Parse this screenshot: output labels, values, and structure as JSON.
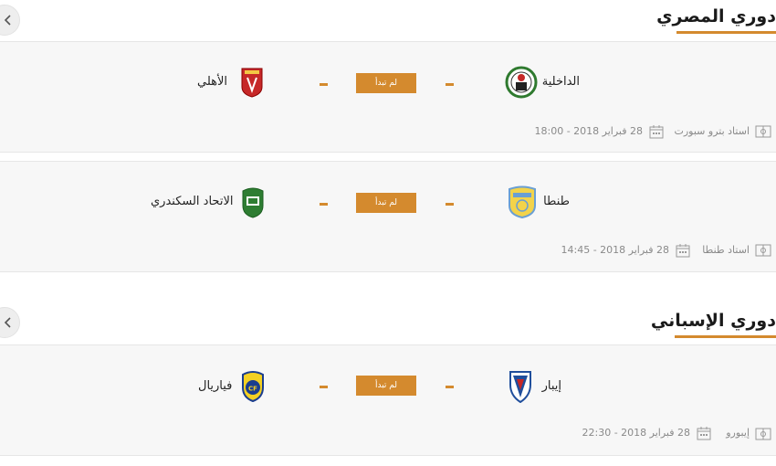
{
  "leagues": [
    {
      "title": "دوري المصري",
      "matches": [
        {
          "home_team": "الداخلية",
          "away_team": "الأهلي",
          "score_home": "-",
          "score_away": "-",
          "status": "لم تبدأ",
          "stadium": "استاد بترو سبورت",
          "date_time": "28 فبراير 2018 - 18:00",
          "home_logo_icon": "aldakhleya-crest-icon",
          "away_logo_icon": "al-ahly-crest-icon"
        },
        {
          "home_team": "طنطا",
          "away_team": "الاتحاد السكندري",
          "score_home": "-",
          "score_away": "-",
          "status": "لم تبدأ",
          "stadium": "استاد طنطا",
          "date_time": "28 فبراير 2018 - 14:45",
          "home_logo_icon": "tanta-crest-icon",
          "away_logo_icon": "al-ittihad-crest-icon"
        }
      ]
    },
    {
      "title": "دوري الإسباني",
      "matches": [
        {
          "home_team": "إيبار",
          "away_team": "فياريال",
          "score_home": "-",
          "score_away": "-",
          "status": "لم تبدأ",
          "stadium": "إيبورو",
          "date_time": "28 فبراير 2018 - 22:30",
          "home_logo_icon": "eibar-crest-icon",
          "away_logo_icon": "villarreal-crest-icon"
        }
      ]
    }
  ],
  "colors": {
    "accent": "#d48a2e",
    "card_background": "#f7f7f7",
    "meta_text": "#8a8a8a"
  }
}
